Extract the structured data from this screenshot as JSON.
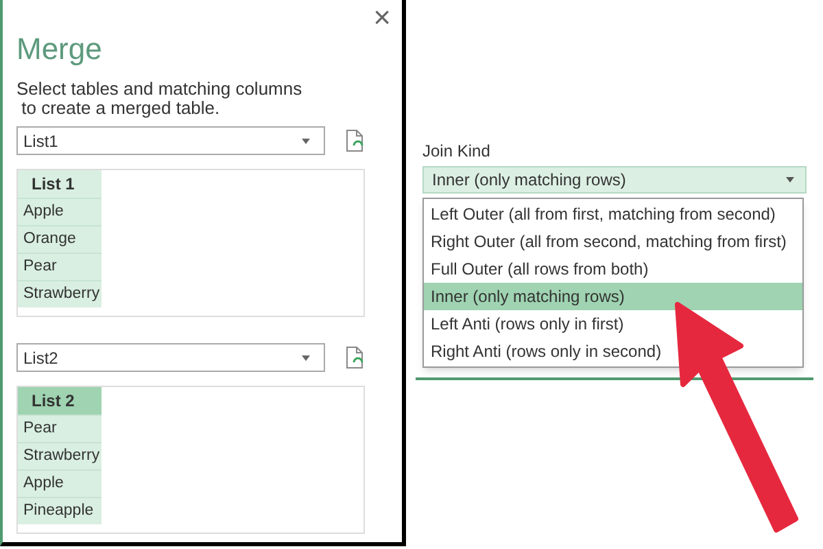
{
  "dialog": {
    "title": "Merge",
    "close": "×",
    "instructions": "Select tables and matching columns\n to create a merged table.",
    "tables": [
      {
        "source": "List1",
        "column": {
          "header": "List 1",
          "selected": false,
          "cells": [
            "Apple",
            "Orange",
            "Pear",
            "Strawberry"
          ]
        }
      },
      {
        "source": "List2",
        "column": {
          "header": "List 2",
          "selected": true,
          "cells": [
            "Pear",
            "Strawberry",
            "Apple",
            "Pineapple"
          ]
        }
      }
    ]
  },
  "join_kind": {
    "label": "Join Kind",
    "value": "Inner (only matching rows)",
    "options": [
      {
        "label": "Left Outer (all from first, matching from second)",
        "selected": false
      },
      {
        "label": "Right Outer (all from second, matching from first)",
        "selected": false
      },
      {
        "label": "Full Outer (all rows from both)",
        "selected": false
      },
      {
        "label": "Inner (only matching rows)",
        "selected": true
      },
      {
        "label": "Left Anti (rows only in first)",
        "selected": false
      },
      {
        "label": "Right Anti (rows only in second)",
        "selected": false
      }
    ]
  }
}
